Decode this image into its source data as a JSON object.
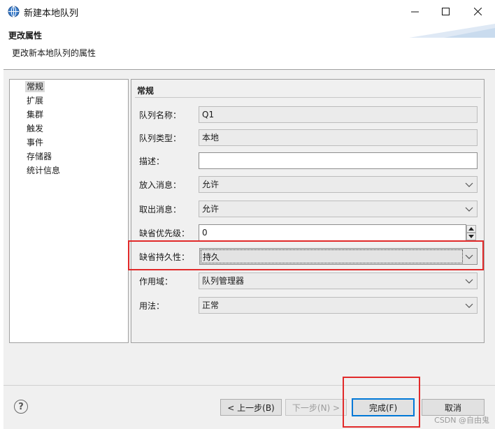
{
  "window": {
    "title": "新建本地队列",
    "controls": {
      "minimize": "—",
      "maximize": "☐",
      "close": "✕"
    }
  },
  "banner": {
    "title": "更改属性",
    "description": "更改新本地队列的属性"
  },
  "nav": {
    "items": [
      "常规",
      "扩展",
      "集群",
      "触发",
      "事件",
      "存储器",
      "统计信息"
    ],
    "selected_index": 0
  },
  "form": {
    "heading": "常规",
    "fields": {
      "queue_name": {
        "label": "队列名称：",
        "value": "Q1"
      },
      "queue_type": {
        "label": "队列类型：",
        "value": "本地"
      },
      "description": {
        "label": "描述：",
        "value": ""
      },
      "put_messages": {
        "label": "放入消息：",
        "value": "允许"
      },
      "get_messages": {
        "label": "取出消息：",
        "value": "允许"
      },
      "default_priority": {
        "label": "缺省优先级：",
        "value": "0"
      },
      "default_persistence": {
        "label": "缺省持久性：",
        "value": "持久"
      },
      "scope": {
        "label": "作用域：",
        "value": "队列管理器"
      },
      "usage": {
        "label": "用法：",
        "value": "正常"
      }
    }
  },
  "buttons": {
    "help": "?",
    "back": "< 上一步(B)",
    "next": "下一步(N) >",
    "finish": "完成(F)",
    "cancel": "取消"
  },
  "watermark": "CSDN @自由鬼",
  "colors": {
    "highlight_red": "#e12a2a",
    "default_button_border": "#0078d7",
    "panel_bg": "#f0f0f0"
  }
}
